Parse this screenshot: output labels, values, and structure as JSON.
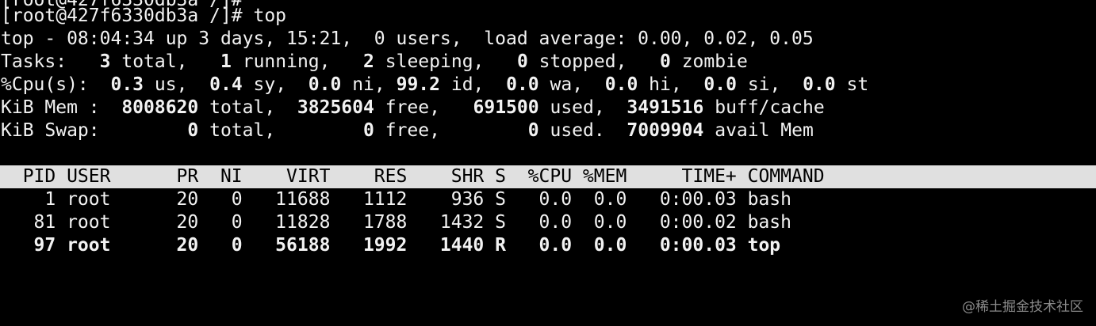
{
  "colors": {
    "background": "#000000",
    "foreground": "#f2f2f2",
    "header_bar": "#e0e0e0",
    "header_text": "#000000",
    "watermark": "#8a8a8a"
  },
  "prompt": {
    "cut_off_top_line": "[root@427f6330db3a /]#",
    "text": "[root@427f6330db3a /]# top"
  },
  "summary": {
    "uptime_line": "top - 08:04:34 up 3 days, 15:21,  0 users,  load average: 0.00, 0.02, 0.05",
    "tasks": {
      "label": "Tasks:",
      "total": "3",
      "total_label": "total,",
      "running": "1",
      "running_label": "running,",
      "sleeping": "2",
      "sleeping_label": "sleeping,",
      "stopped": "0",
      "stopped_label": "stopped,",
      "zombie": "0",
      "zombie_label": "zombie"
    },
    "cpu": {
      "label": "%Cpu(s):",
      "us": "0.3",
      "us_label": "us,",
      "sy": "0.4",
      "sy_label": "sy,",
      "ni": "0.0",
      "ni_label": "ni,",
      "id": "99.2",
      "id_label": "id,",
      "wa": "0.0",
      "wa_label": "wa,",
      "hi": "0.0",
      "hi_label": "hi,",
      "si": "0.0",
      "si_label": "si,",
      "st": "0.0",
      "st_label": "st"
    },
    "mem": {
      "label": "KiB Mem :",
      "total": "8008620",
      "total_label": "total,",
      "free": "3825604",
      "free_label": "free,",
      "used": "691500",
      "used_label": "used,",
      "buff": "3491516",
      "buff_label": "buff/cache"
    },
    "swap": {
      "label": "KiB Swap:",
      "total": "0",
      "total_label": "total,",
      "free": "0",
      "free_label": "free,",
      "used": "0",
      "used_label": "used.",
      "avail": "7009904",
      "avail_label": "avail Mem"
    }
  },
  "process_table": {
    "header": "  PID USER      PR  NI    VIRT    RES    SHR S  %CPU %MEM     TIME+ COMMAND",
    "rows": [
      {
        "line": "    1 root      20   0   11688   1112    936 S   0.0  0.0   0:00.03 bash",
        "bold": false
      },
      {
        "line": "   81 root      20   0   11828   1788   1432 S   0.0  0.0   0:00.02 bash",
        "bold": false
      },
      {
        "line": "   97 root      20   0   56188   1992   1440 R   0.0  0.0   0:00.03 top",
        "bold": true
      }
    ]
  },
  "watermark": "@稀土掘金技术社区"
}
